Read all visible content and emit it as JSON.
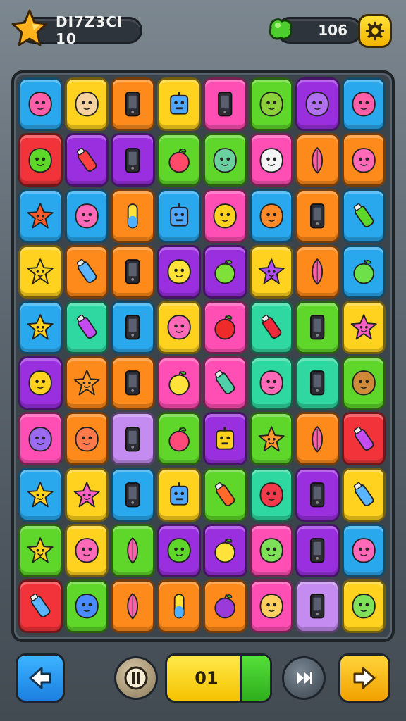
{
  "header": {
    "title": "DI7Z3CI 10",
    "score": "106",
    "star_icon": "star-icon",
    "gem_icon": "green-gem-icon",
    "settings_icon": "gear-icon"
  },
  "footer": {
    "back_icon": "back-arrow-icon",
    "pause_icon": "pause-icon",
    "counter": "01",
    "skip_icon": "skip-icon",
    "next_icon": "next-arrow-icon"
  },
  "colors": {
    "blue": "#2aa8ee",
    "yellow": "#ffd21f",
    "orange": "#ff8a1c",
    "pink": "#ff4fb4",
    "green": "#5fd62a",
    "purple": "#9a2fe0",
    "red": "#f2343a",
    "teal": "#2fd8a0",
    "lavender": "#c48cf0"
  },
  "tiles": [
    {
      "color": "blue",
      "icon": "pink-bird"
    },
    {
      "color": "yellow",
      "icon": "cat-face"
    },
    {
      "color": "orange",
      "icon": "phone"
    },
    {
      "color": "yellow",
      "icon": "robot-face"
    },
    {
      "color": "pink",
      "icon": "phone"
    },
    {
      "color": "green",
      "icon": "monster-face"
    },
    {
      "color": "purple",
      "icon": "bunny"
    },
    {
      "color": "blue",
      "icon": "pink-bird"
    },
    {
      "color": "red",
      "icon": "green-blob"
    },
    {
      "color": "purple",
      "icon": "red-capsule"
    },
    {
      "color": "purple",
      "icon": "phone"
    },
    {
      "color": "green",
      "icon": "apple"
    },
    {
      "color": "green",
      "icon": "pretzel"
    },
    {
      "color": "pink",
      "icon": "ghost"
    },
    {
      "color": "orange",
      "icon": "leaf"
    },
    {
      "color": "orange",
      "icon": "pink-blob"
    },
    {
      "color": "blue",
      "icon": "red-star"
    },
    {
      "color": "blue",
      "icon": "pink-blob"
    },
    {
      "color": "orange",
      "icon": "capsule"
    },
    {
      "color": "blue",
      "icon": "blue-robot"
    },
    {
      "color": "pink",
      "icon": "flame"
    },
    {
      "color": "blue",
      "icon": "orange-ball"
    },
    {
      "color": "orange",
      "icon": "phone"
    },
    {
      "color": "blue",
      "icon": "green-pepper"
    },
    {
      "color": "yellow",
      "icon": "yellow-star"
    },
    {
      "color": "orange",
      "icon": "bottle"
    },
    {
      "color": "orange",
      "icon": "phone"
    },
    {
      "color": "purple",
      "icon": "yellow-bird"
    },
    {
      "color": "purple",
      "icon": "lime"
    },
    {
      "color": "yellow",
      "icon": "purple-star"
    },
    {
      "color": "orange",
      "icon": "leaf"
    },
    {
      "color": "blue",
      "icon": "green-apple"
    },
    {
      "color": "blue",
      "icon": "yellow-star"
    },
    {
      "color": "teal",
      "icon": "crayon"
    },
    {
      "color": "blue",
      "icon": "phone"
    },
    {
      "color": "yellow",
      "icon": "pink-blob"
    },
    {
      "color": "pink",
      "icon": "red-apple"
    },
    {
      "color": "teal",
      "icon": "red-sock"
    },
    {
      "color": "green",
      "icon": "phone"
    },
    {
      "color": "yellow",
      "icon": "pink-star"
    },
    {
      "color": "purple",
      "icon": "yellow-blob"
    },
    {
      "color": "orange",
      "icon": "orange-star"
    },
    {
      "color": "orange",
      "icon": "phone"
    },
    {
      "color": "pink",
      "icon": "lemon"
    },
    {
      "color": "pink",
      "icon": "jar"
    },
    {
      "color": "teal",
      "icon": "pink-blob"
    },
    {
      "color": "teal",
      "icon": "phone"
    },
    {
      "color": "green",
      "icon": "brown-pig"
    },
    {
      "color": "pink",
      "icon": "purple-bird"
    },
    {
      "color": "orange",
      "icon": "bird-hat"
    },
    {
      "color": "lavender",
      "icon": "phone"
    },
    {
      "color": "green",
      "icon": "balloon"
    },
    {
      "color": "purple",
      "icon": "box-robot"
    },
    {
      "color": "green",
      "icon": "orange-star"
    },
    {
      "color": "orange",
      "icon": "leaf"
    },
    {
      "color": "red",
      "icon": "purple-gem"
    },
    {
      "color": "blue",
      "icon": "yellow-star"
    },
    {
      "color": "yellow",
      "icon": "pink-star"
    },
    {
      "color": "blue",
      "icon": "phone"
    },
    {
      "color": "yellow",
      "icon": "blue-robot"
    },
    {
      "color": "green",
      "icon": "carrot"
    },
    {
      "color": "teal",
      "icon": "red-blob"
    },
    {
      "color": "purple",
      "icon": "phone"
    },
    {
      "color": "yellow",
      "icon": "bottle"
    },
    {
      "color": "green",
      "icon": "yellow-star"
    },
    {
      "color": "yellow",
      "icon": "pink-blob"
    },
    {
      "color": "green",
      "icon": "leaf"
    },
    {
      "color": "purple",
      "icon": "green-virus"
    },
    {
      "color": "purple",
      "icon": "lemon"
    },
    {
      "color": "pink",
      "icon": "green-monster"
    },
    {
      "color": "purple",
      "icon": "phone"
    },
    {
      "color": "blue",
      "icon": "pink-blob"
    },
    {
      "color": "red",
      "icon": "bottle"
    },
    {
      "color": "green",
      "icon": "blue-monster"
    },
    {
      "color": "orange",
      "icon": "leaf"
    },
    {
      "color": "orange",
      "icon": "capsule"
    },
    {
      "color": "orange",
      "icon": "plum"
    },
    {
      "color": "pink",
      "icon": "lion-face"
    },
    {
      "color": "lavender",
      "icon": "phone"
    },
    {
      "color": "yellow",
      "icon": "green-monster"
    }
  ]
}
